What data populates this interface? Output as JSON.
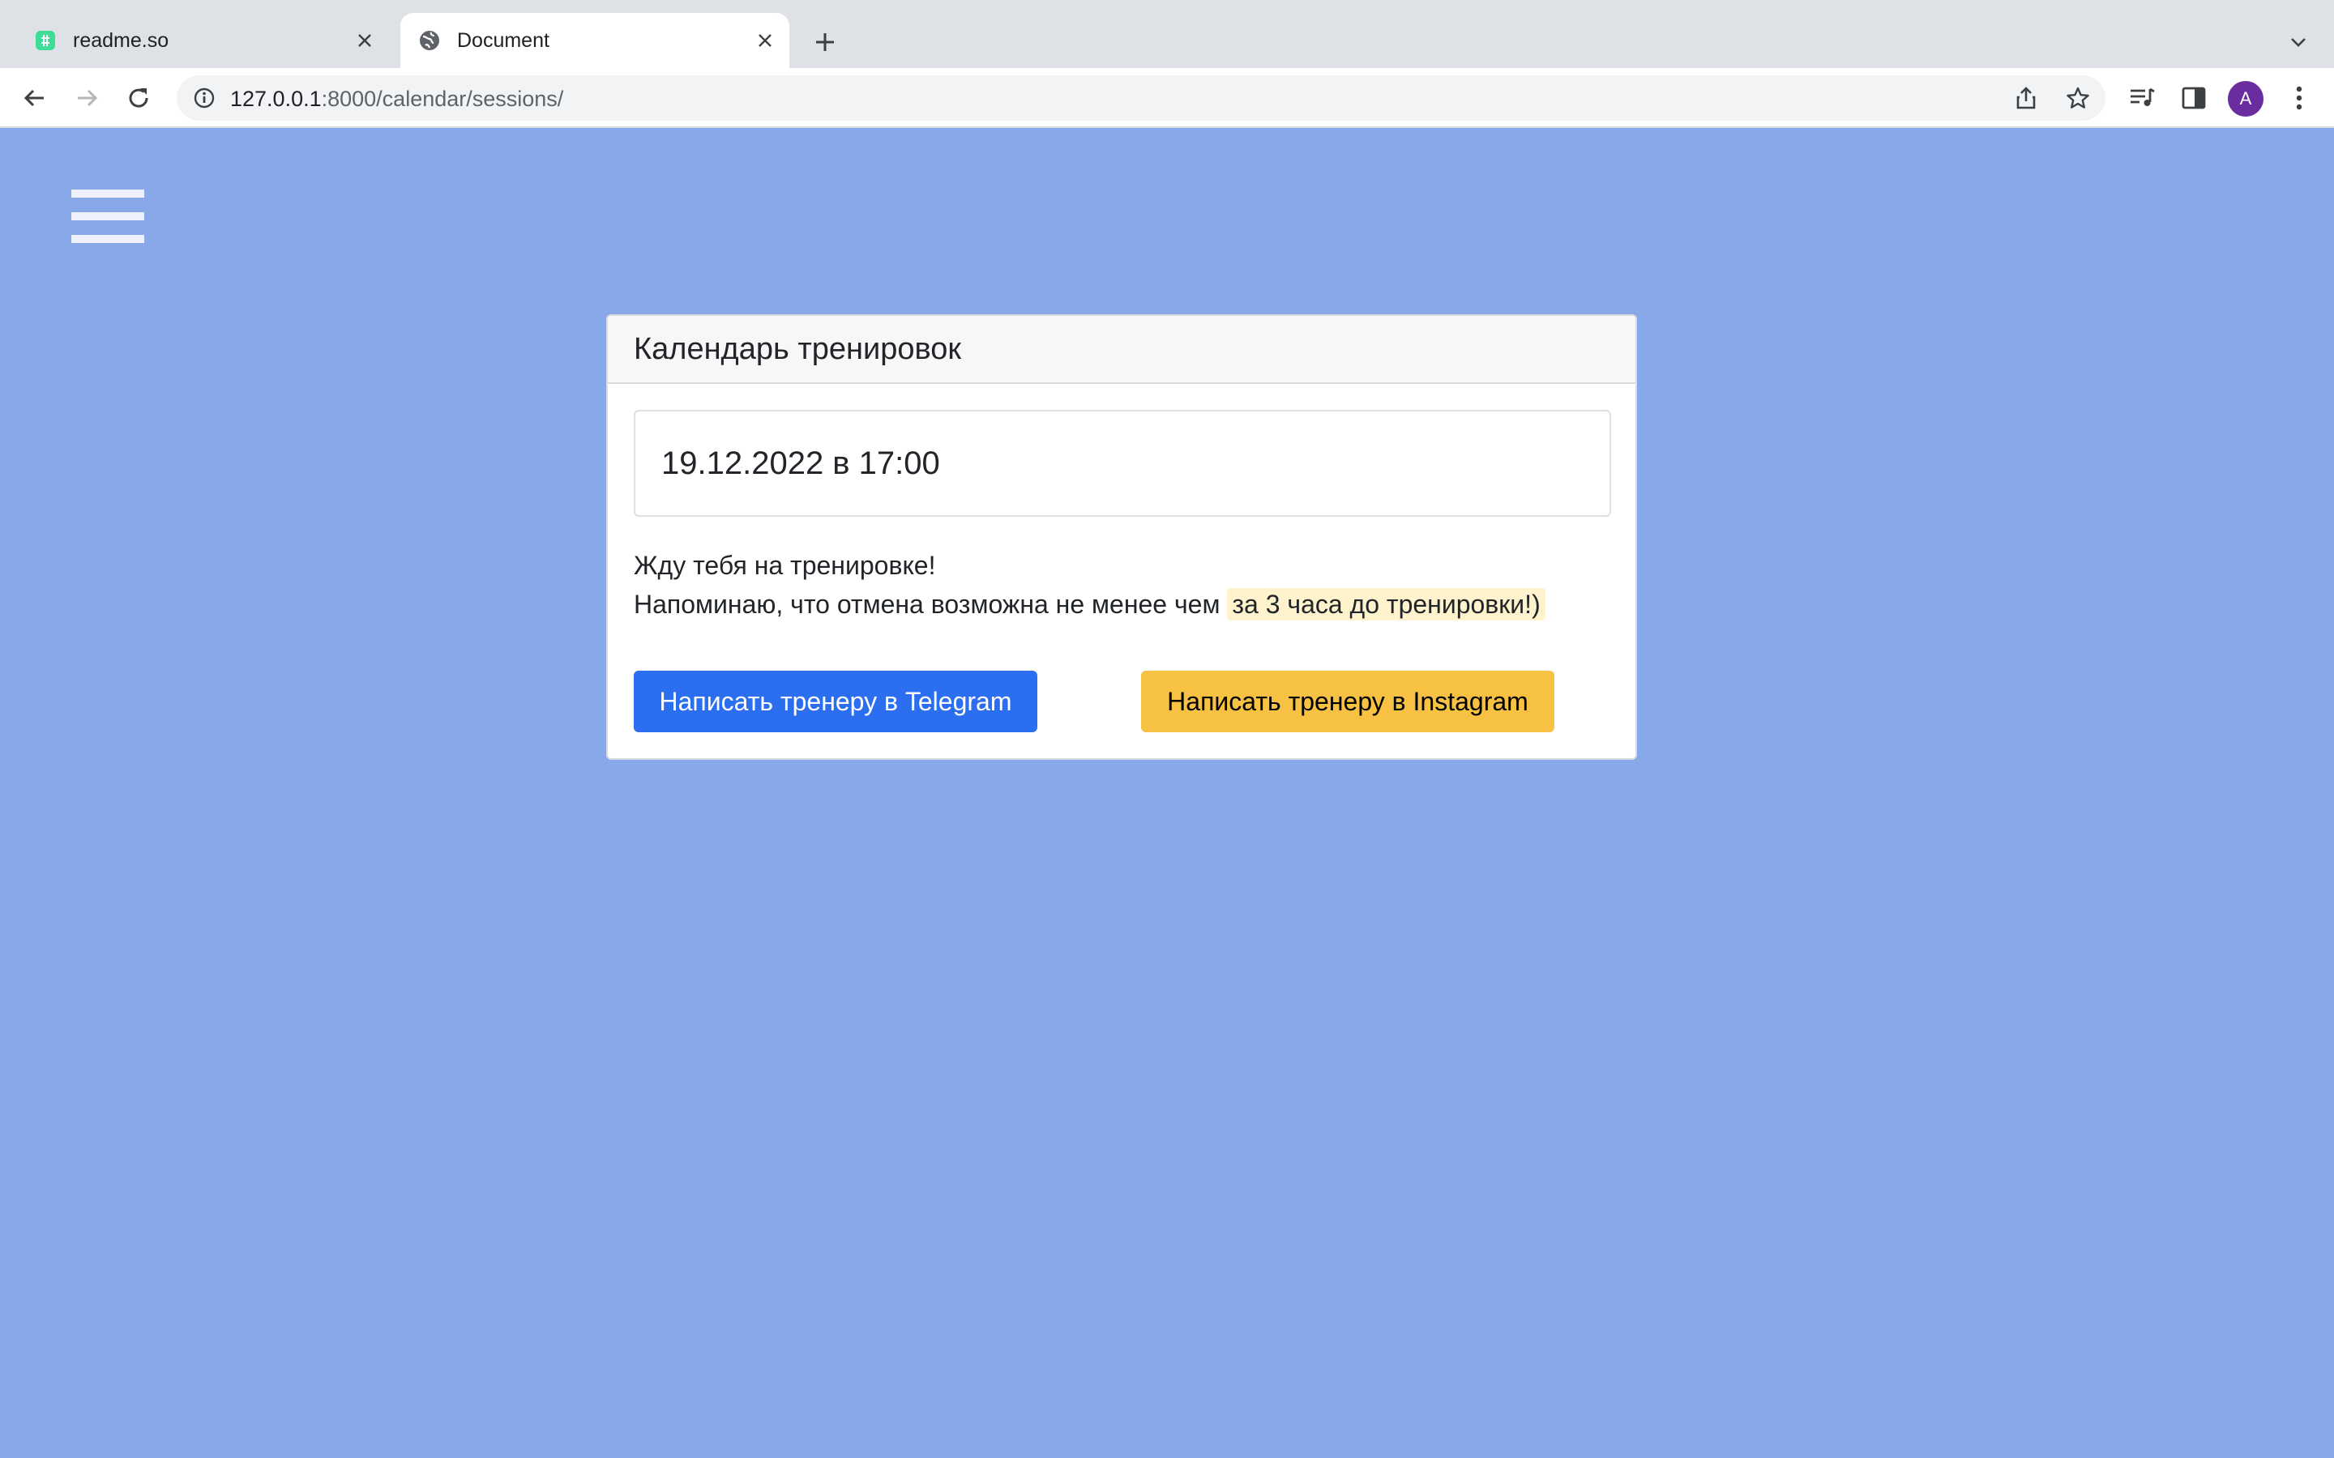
{
  "browser": {
    "tabs": [
      {
        "title": "readme.so",
        "active": false,
        "favicon": "readme-favicon"
      },
      {
        "title": "Document",
        "active": true,
        "favicon": "globe-icon"
      }
    ],
    "url": {
      "host": "127.0.0.1",
      "rest": ":8000/calendar/sessions/"
    },
    "profile_initial": "A",
    "profile_color": "#6b2ca0"
  },
  "page": {
    "background": "#89a8e9",
    "card": {
      "title": "Календарь тренировок",
      "session_datetime": "19.12.2022 в 17:00",
      "message_line1": "Жду тебя на тренировке!",
      "message_line2": "Напоминаю, что отмена возможна не менее чем",
      "message_highlight": "за 3 часа до тренировки!)"
    },
    "buttons": {
      "telegram": {
        "label": "Написать тренеру в Telegram",
        "color": "#2b6ef0"
      },
      "instagram": {
        "label": "Написать тренеру в Instagram",
        "color": "#f7c143"
      }
    }
  }
}
